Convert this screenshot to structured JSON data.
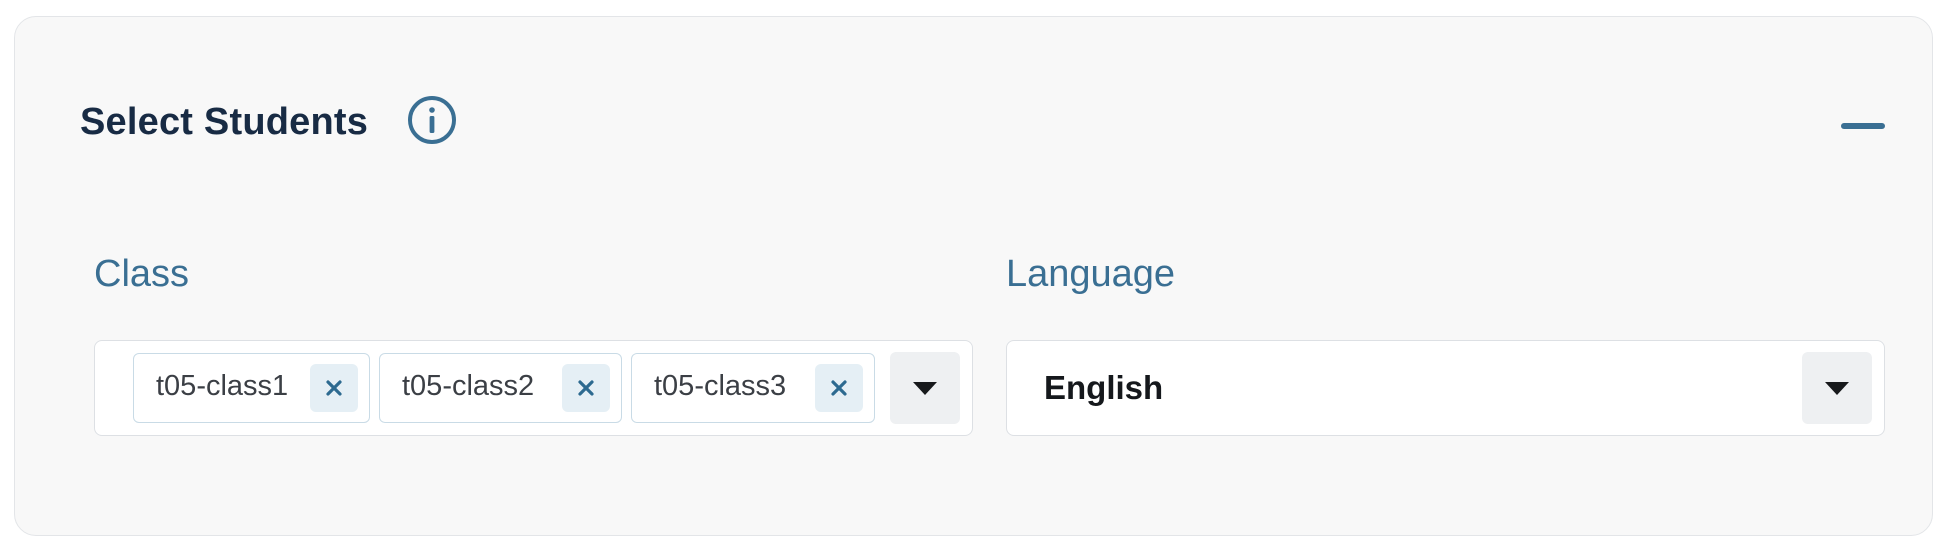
{
  "section": {
    "title": "Select Students"
  },
  "icons": {
    "info": "info-circle-icon",
    "collapse": "minus-icon",
    "remove": "close-icon",
    "dropdown": "caret-down-icon"
  },
  "fields": {
    "class": {
      "label": "Class",
      "selected": [
        {
          "label": "t05-class1"
        },
        {
          "label": "t05-class2"
        },
        {
          "label": "t05-class3"
        }
      ]
    },
    "language": {
      "label": "Language",
      "value": "English"
    }
  },
  "colors": {
    "accent": "#3a6f93",
    "title": "#182b44",
    "panel_background": "#f8f8f8",
    "chip_remove_background": "#e5eff5"
  }
}
